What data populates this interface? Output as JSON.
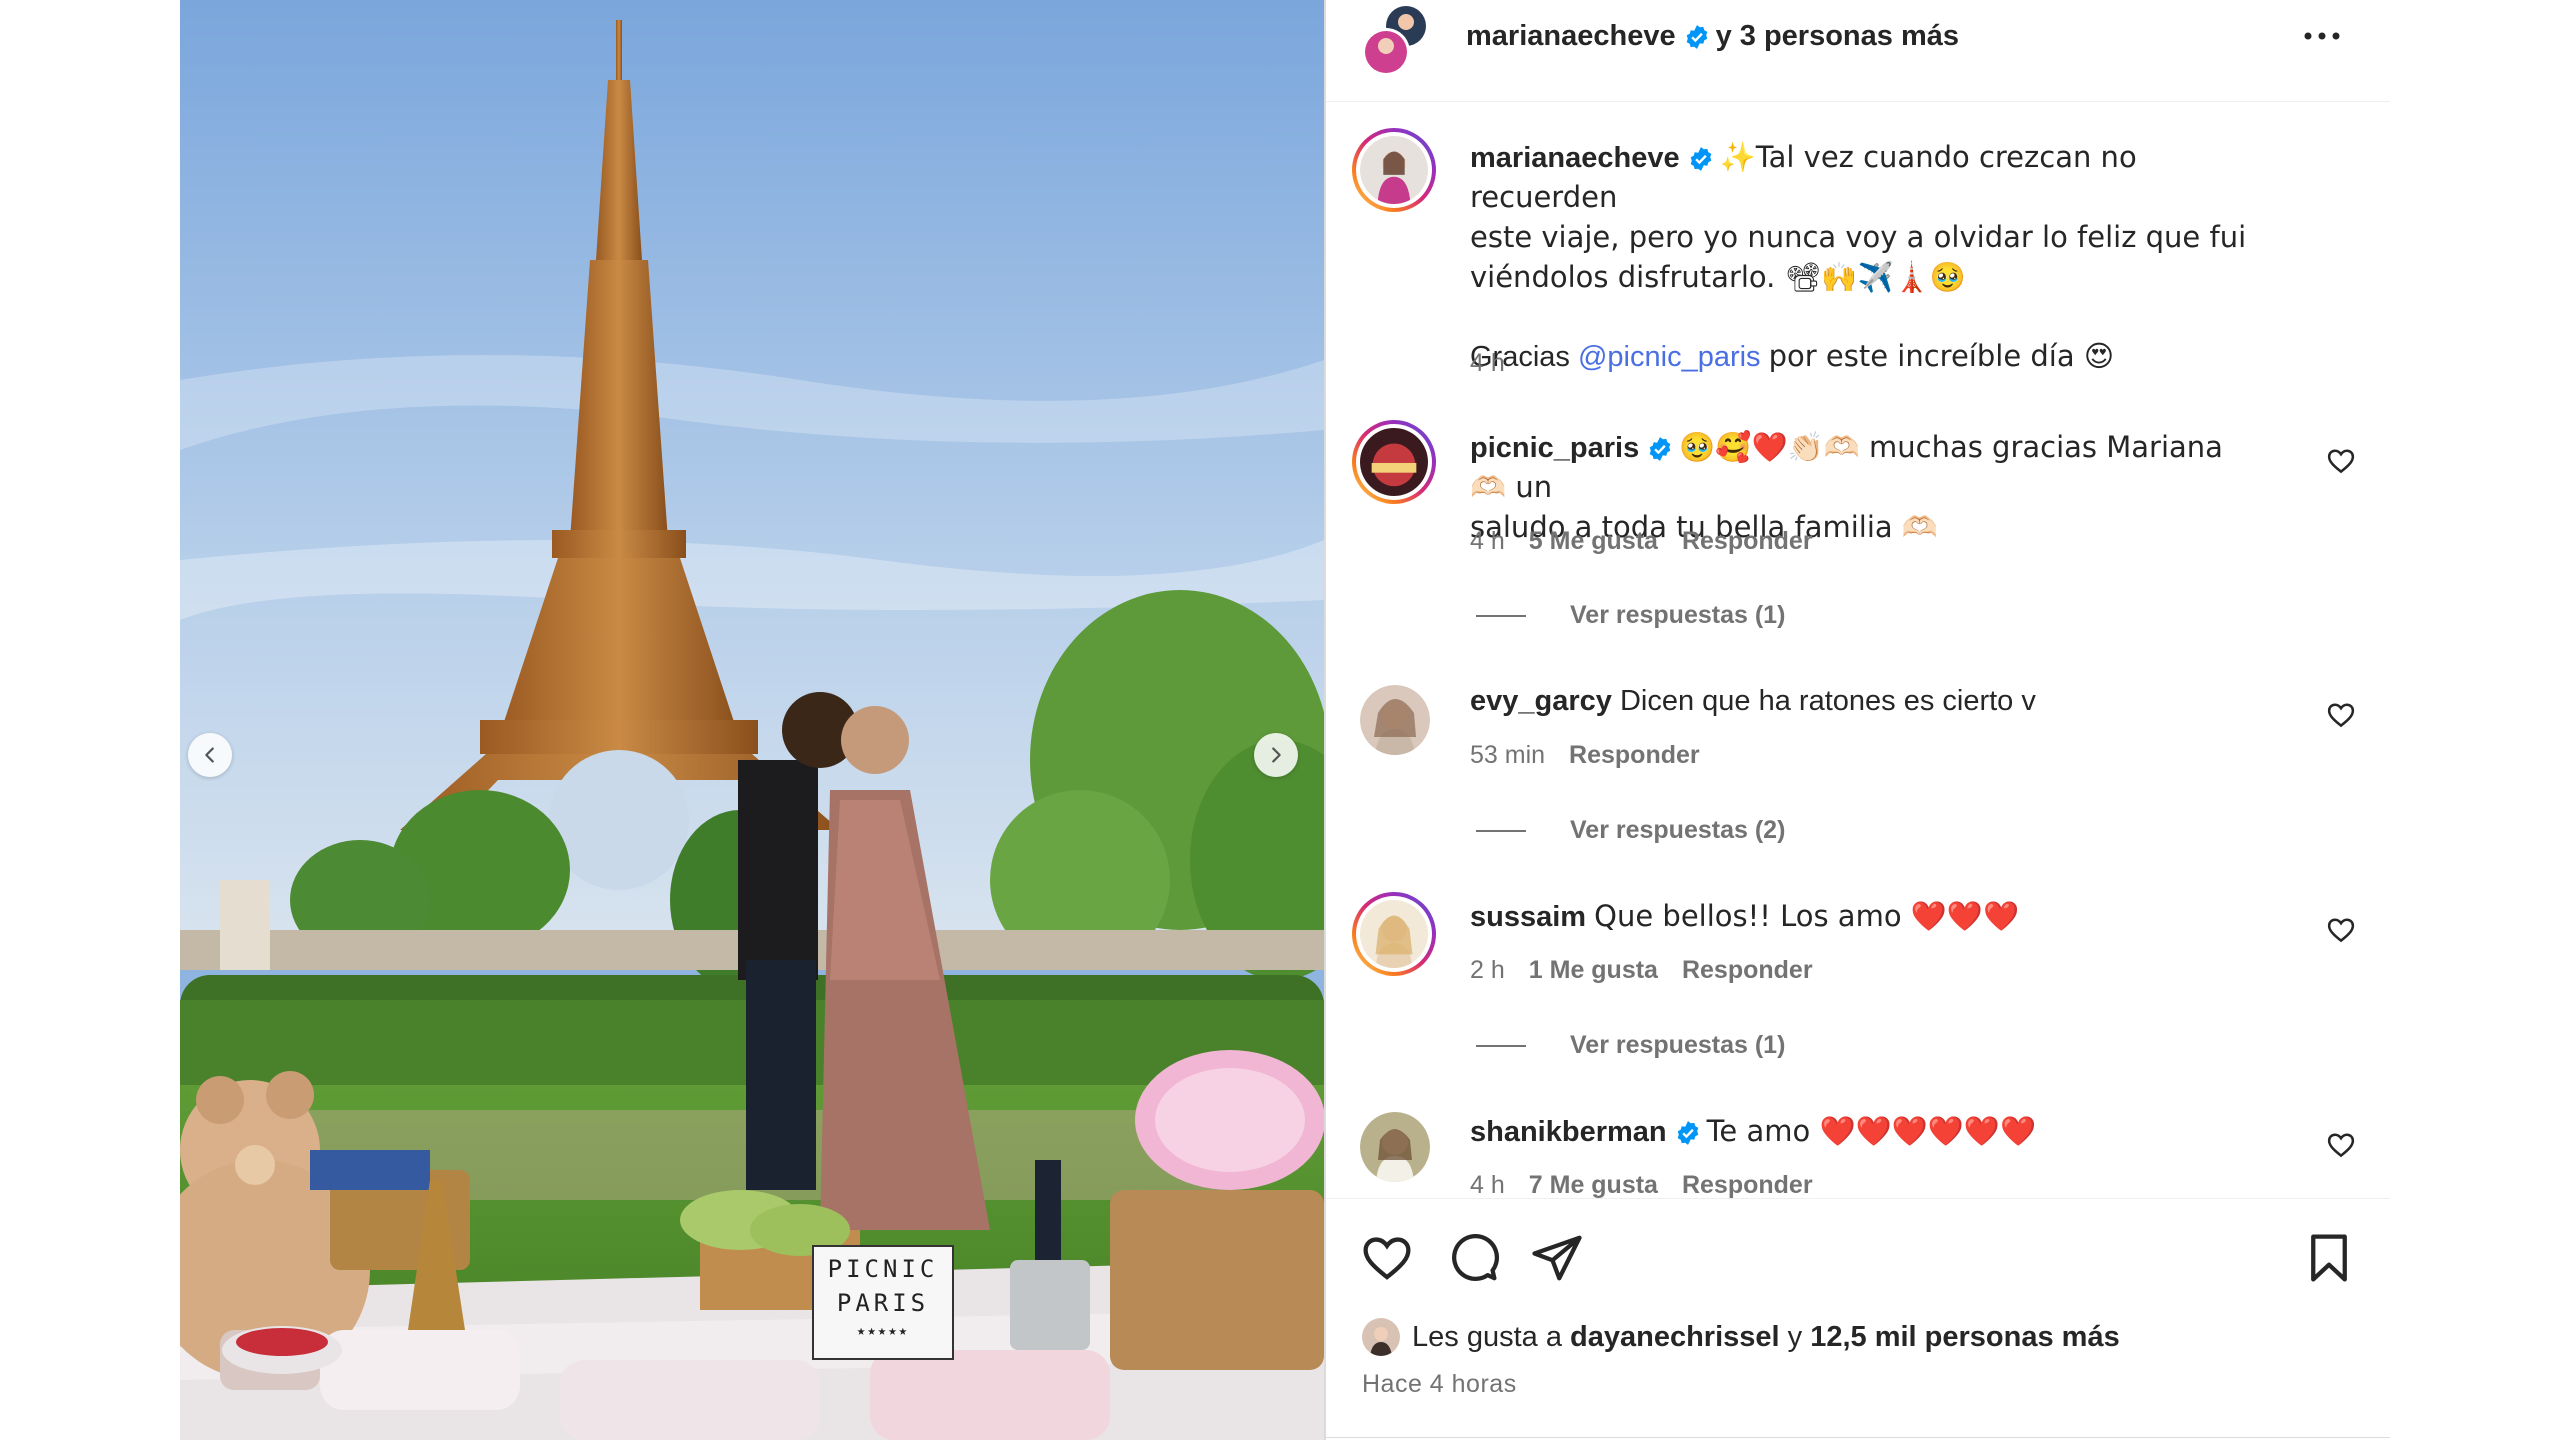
{
  "post": {
    "author": "marianaecheve",
    "header_suffix": "y 3 personas más",
    "nav_prev_icon": "chevron-left-icon",
    "nav_next_icon": "chevron-right-icon",
    "photo_sign_line1": "PICNIC",
    "photo_sign_line2": "PARIS",
    "photo_sign_stars": "★★★★★"
  },
  "caption": {
    "username": "marianaecheve",
    "text_line1": "✨Tal vez cuando crezcan no recuerden",
    "text_line2": "este viaje, pero yo nunca voy a olvidar lo feliz que fui",
    "text_line3": "viéndolos disfrutarlo. 📽🙌✈️🗼🥹",
    "thanks_prefix": "Gracias",
    "thanks_mention": "@picnic_paris",
    "thanks_suffix": "por este increíble día 😍",
    "time": "4 h"
  },
  "comments": [
    {
      "username": "picnic_paris",
      "verified": true,
      "text_line1": "🥹🥰❤️👏🏻🫶🏻 muchas gracias Mariana 🫶🏻 un",
      "text_line2": "saludo a toda tu bella familia 🫶🏻",
      "time": "4 h",
      "likes": "5 Me gusta",
      "reply": "Responder",
      "view_replies": "Ver respuestas (1)"
    },
    {
      "username": "evy_garcy",
      "verified": false,
      "text_line1": "Dicen que ha ratones es cierto v",
      "time": "53 min",
      "reply": "Responder",
      "view_replies": "Ver respuestas (2)"
    },
    {
      "username": "sussaim",
      "verified": false,
      "text_line1": "Que bellos!! Los amo ❤️❤️❤️",
      "time": "2 h",
      "likes": "1 Me gusta",
      "reply": "Responder",
      "view_replies": "Ver respuestas (1)"
    },
    {
      "username": "shanikberman",
      "verified": true,
      "text_line1": "Te amo ❤️❤️❤️❤️❤️❤️",
      "time": "4 h",
      "likes": "7 Me gusta",
      "reply": "Responder"
    }
  ],
  "actions": {
    "like_icon": "heart-icon",
    "comment_icon": "comment-icon",
    "share_icon": "send-icon",
    "save_icon": "bookmark-icon",
    "likes_prefix": "Les gusta a",
    "likes_user": "dayanechrissel",
    "likes_and": "y",
    "likes_count": "12,5 mil personas más",
    "time_ago": "Hace 4 horas"
  },
  "colors": {
    "verified": "#0095f6",
    "link": "#4a6fe3",
    "muted": "#737373",
    "text": "#262626"
  }
}
